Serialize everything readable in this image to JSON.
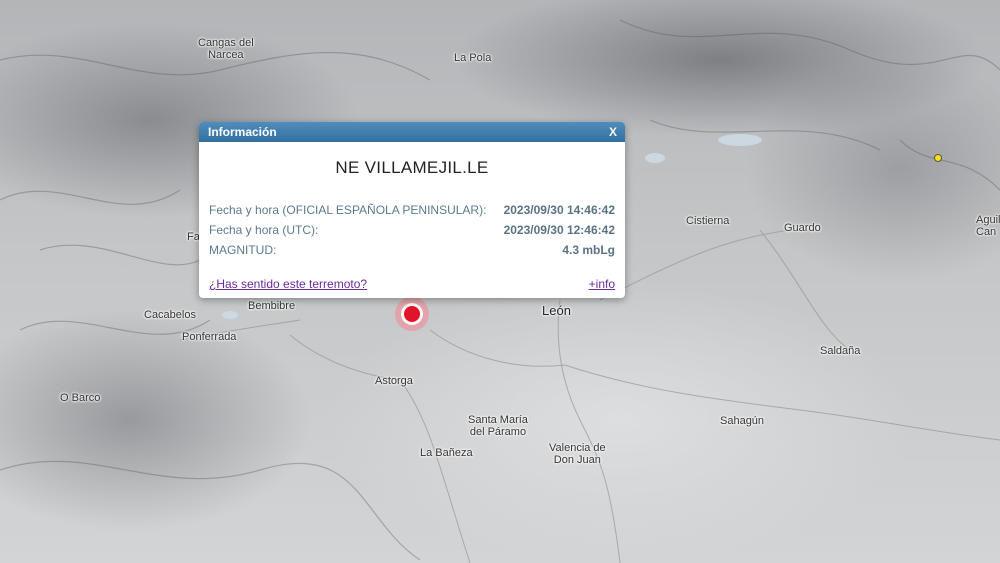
{
  "map": {
    "places": [
      {
        "id": "cangas",
        "label": "Cangas del\nNarcea"
      },
      {
        "id": "lapola",
        "label": "La Pola"
      },
      {
        "id": "cistierna",
        "label": "Cistierna"
      },
      {
        "id": "guardo",
        "label": "Guardo"
      },
      {
        "id": "aguilar",
        "label": "Aguil\nCan"
      },
      {
        "id": "fa",
        "label": "Fa"
      },
      {
        "id": "bembibre",
        "label": "Bembibre"
      },
      {
        "id": "cacabelos",
        "label": "Cacabelos"
      },
      {
        "id": "ponferrada",
        "label": "Ponferrada"
      },
      {
        "id": "leon",
        "label": "León"
      },
      {
        "id": "saldana",
        "label": "Saldaña"
      },
      {
        "id": "astorga",
        "label": "Astorga"
      },
      {
        "id": "obarco",
        "label": "O Barco"
      },
      {
        "id": "santamaria",
        "label": "Santa María\ndel Páramo"
      },
      {
        "id": "sahagun",
        "label": "Sahagún"
      },
      {
        "id": "labaneza",
        "label": "La Bañeza"
      },
      {
        "id": "valencia",
        "label": "Valencia de\nDon Juan"
      }
    ],
    "epicenter_color": "#e0142a",
    "station_color": "#ffe400"
  },
  "popup": {
    "title": "Información",
    "close_label": "X",
    "event_name": "NE VILLAMEJIL.LE",
    "rows": [
      {
        "label": "Fecha y hora (OFICIAL ESPAÑOLA PENINSULAR):",
        "value": "2023/09/30 14:46:42"
      },
      {
        "label": "Fecha y hora (UTC):",
        "value": "2023/09/30 12:46:42"
      },
      {
        "label": "MAGNITUD:",
        "value": "4.3 mbLg"
      }
    ],
    "felt_link": "¿Has sentido este terremoto?",
    "more_link": "+info",
    "header_color": "#3f7fb0"
  }
}
